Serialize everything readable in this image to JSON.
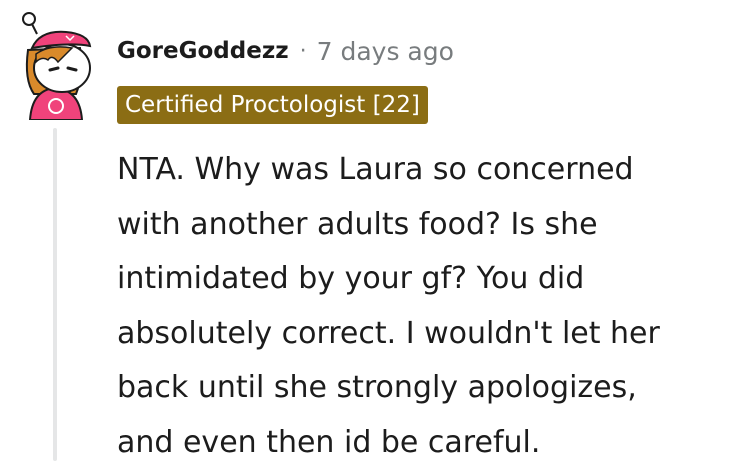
{
  "comment": {
    "username": "GoreGoddezz",
    "separator": "·",
    "timestamp": "7 days ago",
    "flair": "Certified Proctologist [22]",
    "body_lines": [
      "NTA. Why was Laura so concerned",
      "with another adults food? Is she",
      "intimidated by your gf? You did",
      "absolutely correct. I wouldn't let her",
      "back until she strongly apologizes,",
      "and even then id be careful."
    ]
  },
  "colors": {
    "flair_background": "#8b6d14",
    "flair_text": "#ffffff",
    "username": "#1c1c1c",
    "meta_text": "#787c7e",
    "thread_line": "#e5e6e7",
    "avatar_hair": "#d98a2b",
    "avatar_outfit": "#f0437b"
  },
  "avatar": {
    "icon": "user-avatar-icon"
  }
}
